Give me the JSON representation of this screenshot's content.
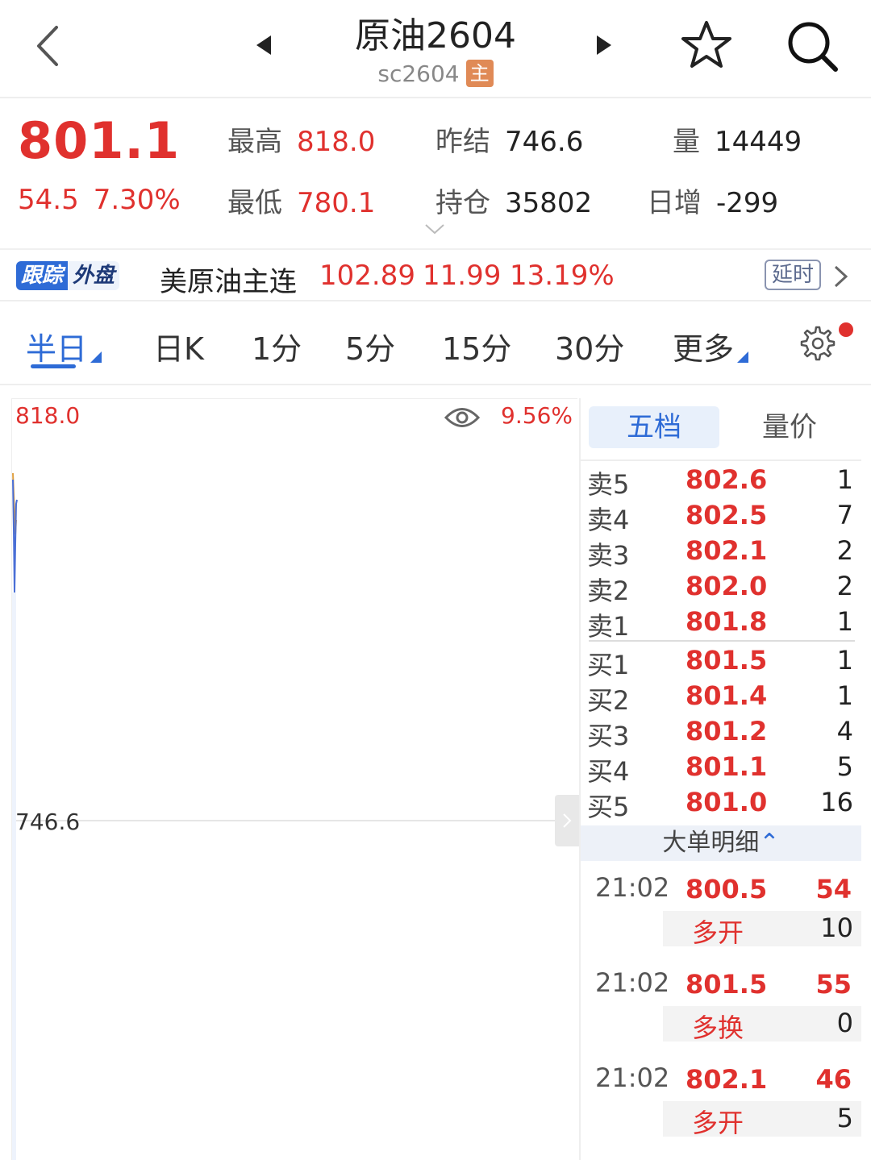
{
  "header": {
    "title": "原油2604",
    "code": "sc2604",
    "main_badge": "主"
  },
  "quote": {
    "last": "801.1",
    "change": "54.5",
    "change_pct": "7.30%",
    "high_label": "最高",
    "high": "818.0",
    "low_label": "最低",
    "low": "780.1",
    "prev_settle_label": "昨结",
    "prev_settle": "746.6",
    "open_interest_label": "持仓",
    "open_interest": "35802",
    "volume_label": "量",
    "volume": "14449",
    "daily_change_label": "日增",
    "daily_change": "-299"
  },
  "tracking": {
    "badge_left": "跟踪",
    "badge_right": "外盘",
    "name": "美原油主连",
    "price": "102.89",
    "change": "11.99",
    "change_pct": "13.19%",
    "delay_label": "延时"
  },
  "tabs": [
    {
      "label": "半日",
      "active": true
    },
    {
      "label": "日K"
    },
    {
      "label": "1分"
    },
    {
      "label": "5分"
    },
    {
      "label": "15分"
    },
    {
      "label": "30分"
    },
    {
      "label": "更多"
    }
  ],
  "chart": {
    "high_label": "818.0",
    "base_label": "746.6",
    "pct_label": "9.56%"
  },
  "book": {
    "tabs": [
      "五档",
      "量价"
    ],
    "asks": [
      {
        "label": "卖5",
        "price": "802.6",
        "qty": "1"
      },
      {
        "label": "卖4",
        "price": "802.5",
        "qty": "7"
      },
      {
        "label": "卖3",
        "price": "802.1",
        "qty": "2"
      },
      {
        "label": "卖2",
        "price": "802.0",
        "qty": "2"
      },
      {
        "label": "卖1",
        "price": "801.8",
        "qty": "1"
      }
    ],
    "bids": [
      {
        "label": "买1",
        "price": "801.5",
        "qty": "1"
      },
      {
        "label": "买2",
        "price": "801.4",
        "qty": "1"
      },
      {
        "label": "买3",
        "price": "801.2",
        "qty": "4"
      },
      {
        "label": "买4",
        "price": "801.1",
        "qty": "5"
      },
      {
        "label": "买5",
        "price": "801.0",
        "qty": "16"
      }
    ],
    "big_orders_title": "大单明细",
    "big_orders": [
      {
        "time": "21:02",
        "price": "800.5",
        "volume": "54",
        "type": "多开",
        "n": "10"
      },
      {
        "time": "21:02",
        "price": "801.5",
        "volume": "55",
        "type": "多换",
        "n": "0"
      },
      {
        "time": "21:02",
        "price": "802.1",
        "volume": "46",
        "type": "多开",
        "n": "5"
      }
    ]
  },
  "colors": {
    "up_red": "#e0312e",
    "accent_blue": "#2e6bd6",
    "badge_orange": "#e08a56"
  }
}
